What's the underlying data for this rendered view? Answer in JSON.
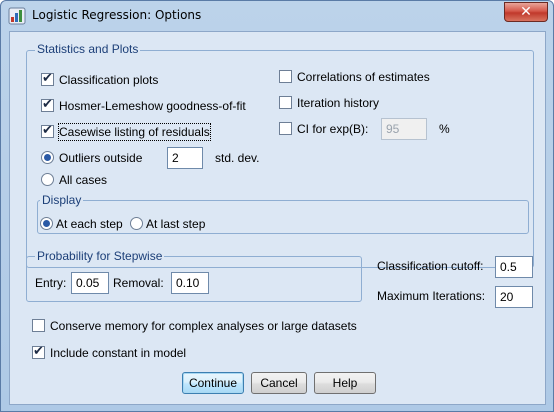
{
  "window": {
    "title": "Logistic Regression: Options",
    "close_glyph": "✕"
  },
  "statistics": {
    "legend": "Statistics and Plots",
    "classification_plots": {
      "label": "Classification plots",
      "checked": true
    },
    "hosmer_lemeshow": {
      "label": "Hosmer-Lemeshow goodness-of-fit",
      "checked": true
    },
    "casewise": {
      "label": "Casewise listing of residuals",
      "checked": true
    },
    "outliers": {
      "label": "Outliers outside",
      "value": "2",
      "unit": "std. dev.",
      "selected": true
    },
    "all_cases": {
      "label": "All cases",
      "selected": false
    },
    "correlations": {
      "label": "Correlations of estimates",
      "checked": false
    },
    "iteration_history": {
      "label": "Iteration history",
      "checked": false
    },
    "ci_exp": {
      "label": "CI for exp(B):",
      "value": "95",
      "unit": "%",
      "checked": false
    }
  },
  "display": {
    "legend": "Display",
    "each_step": {
      "label": "At each step",
      "selected": true
    },
    "last_step": {
      "label": "At last step",
      "selected": false
    }
  },
  "stepwise": {
    "legend": "Probability for Stepwise",
    "entry_label": "Entry:",
    "entry_value": "0.05",
    "removal_label": "Removal:",
    "removal_value": "0.10"
  },
  "cutoff": {
    "label": "Classification cutoff:",
    "value": "0.5"
  },
  "max_iter": {
    "label": "Maximum Iterations:",
    "value": "20"
  },
  "conserve_memory": {
    "label": "Conserve memory for complex analyses or large datasets",
    "checked": false
  },
  "include_constant": {
    "label": "Include constant in model",
    "checked": true
  },
  "buttons": {
    "continue": "Continue",
    "cancel": "Cancel",
    "help": "Help"
  },
  "colors": {
    "frame": "#aec9e6",
    "client": "#dce7f4",
    "group_border": "#8faed2",
    "legend_text": "#1c3f78"
  }
}
